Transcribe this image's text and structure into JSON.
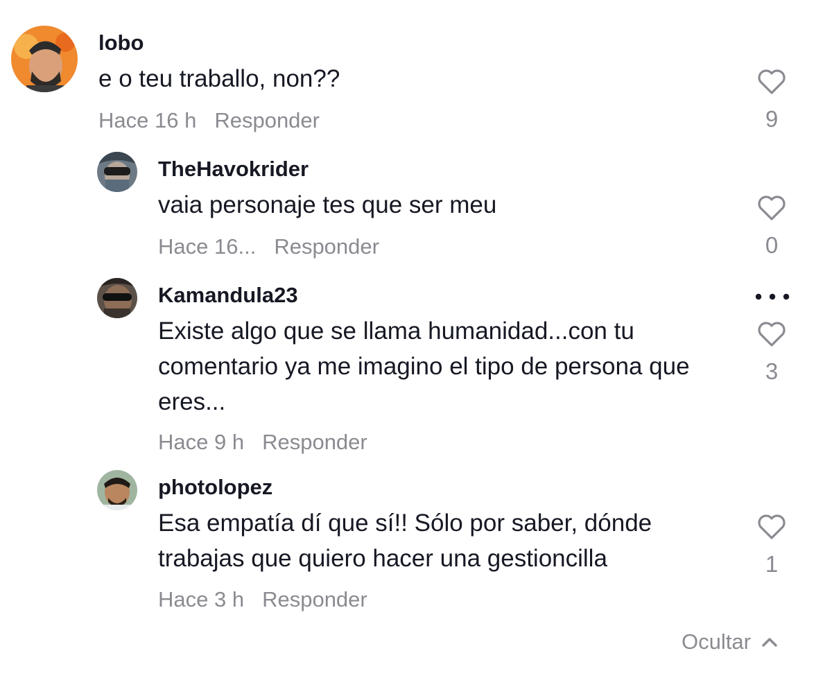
{
  "comments": [
    {
      "username": "lobo",
      "text": "e o teu traballo, non??",
      "time": "Hace 16 h",
      "reply_label": "Responder",
      "likes": "9"
    }
  ],
  "replies": [
    {
      "username": "TheHavokrider",
      "text": "vaia personaje tes que ser meu",
      "time": "Hace 16...",
      "reply_label": "Responder",
      "likes": "0"
    },
    {
      "username": "Kamandula23",
      "text": "Existe algo que se llama humanidad...con tu comentario ya me imagino el tipo de persona que eres...",
      "time": "Hace 9 h",
      "reply_label": "Responder",
      "likes": "3"
    },
    {
      "username": "photolopez",
      "text": "Esa empatía dí que sí!! Sólo por saber, dónde trabajas que quiero hacer una gestioncilla",
      "time": "Hace 3 h",
      "reply_label": "Responder",
      "likes": "1"
    }
  ],
  "hide_label": "Ocultar",
  "icons": {
    "like": "heart-outline-icon",
    "more": "more-horizontal-icon",
    "collapse": "chevron-up-icon"
  },
  "colors": {
    "text": "#161823",
    "muted": "#8a8b91"
  }
}
